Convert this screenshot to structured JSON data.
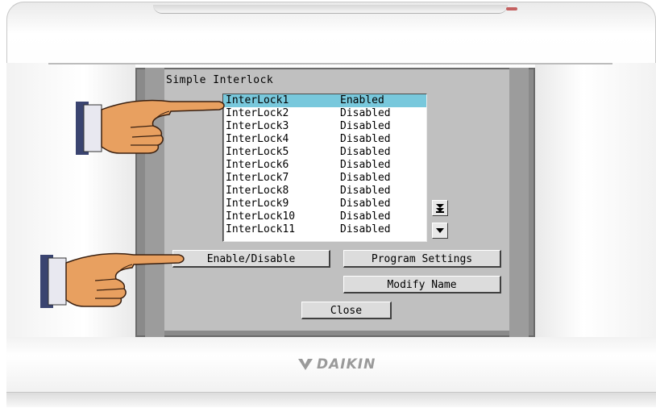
{
  "screen": {
    "title": "Simple Interlock",
    "selected_index": 0,
    "interlocks": [
      {
        "name": "InterLock1",
        "status": "Enabled"
      },
      {
        "name": "InterLock2",
        "status": "Disabled"
      },
      {
        "name": "InterLock3",
        "status": "Disabled"
      },
      {
        "name": "InterLock4",
        "status": "Disabled"
      },
      {
        "name": "InterLock5",
        "status": "Disabled"
      },
      {
        "name": "InterLock6",
        "status": "Disabled"
      },
      {
        "name": "InterLock7",
        "status": "Disabled"
      },
      {
        "name": "InterLock8",
        "status": "Disabled"
      },
      {
        "name": "InterLock9",
        "status": "Disabled"
      },
      {
        "name": "InterLock10",
        "status": "Disabled"
      },
      {
        "name": "InterLock11",
        "status": "Disabled"
      }
    ],
    "buttons": {
      "enable_disable": "Enable/Disable",
      "program_settings": "Program Settings",
      "modify_name": "Modify Name",
      "close": "Close"
    },
    "scroll": {
      "fast_down_icon": "double-arrow-down-icon",
      "down_icon": "arrow-down-icon"
    }
  },
  "device": {
    "brand": "DAIKIN"
  },
  "colors": {
    "selection": "#78c8dc",
    "lcd_background": "#c0c0c0",
    "brand_gray": "#9a9a9a"
  }
}
